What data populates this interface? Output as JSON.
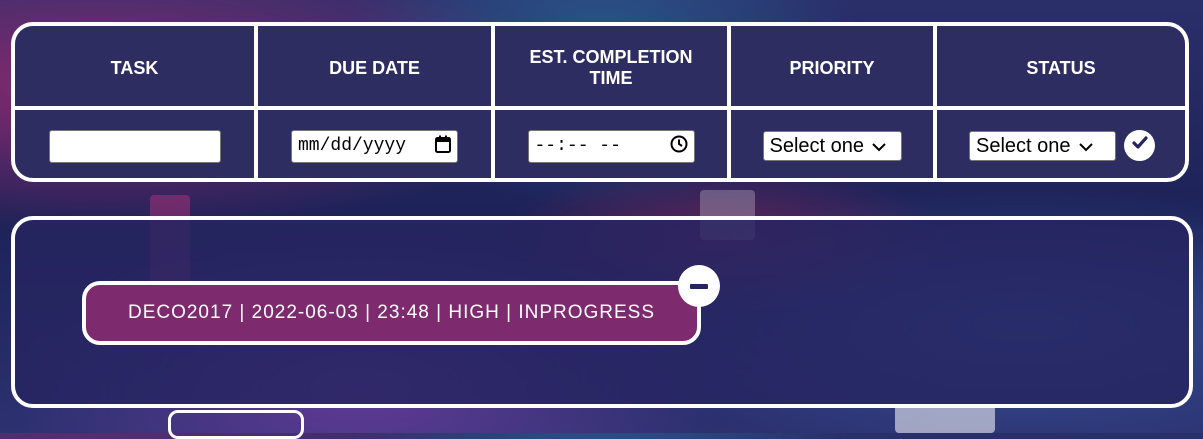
{
  "headers": {
    "task": "TASK",
    "due_date": "DUE DATE",
    "est_completion_line1": "EST. COMPLETION",
    "est_completion_line2": "TIME",
    "priority": "PRIORITY",
    "status": "STATUS"
  },
  "form": {
    "task_value": "",
    "due_date_placeholder": "mm/dd/yyyy",
    "time_placeholder": "--:-- --",
    "priority_selected": "Select one",
    "status_selected": "Select one"
  },
  "tasks": [
    {
      "text": "DECO2017 | 2022-06-03 | 23:48 | HIGH | INPROGRESS"
    }
  ],
  "colors": {
    "panel": "#26245e",
    "task_item": "#7d2a6e",
    "border": "#ffffff"
  },
  "icons": {
    "calendar": "calendar-icon",
    "clock": "clock-icon",
    "dropdown": "chevron-down-icon",
    "submit": "check-circle-icon",
    "remove": "minus-circle-icon"
  }
}
